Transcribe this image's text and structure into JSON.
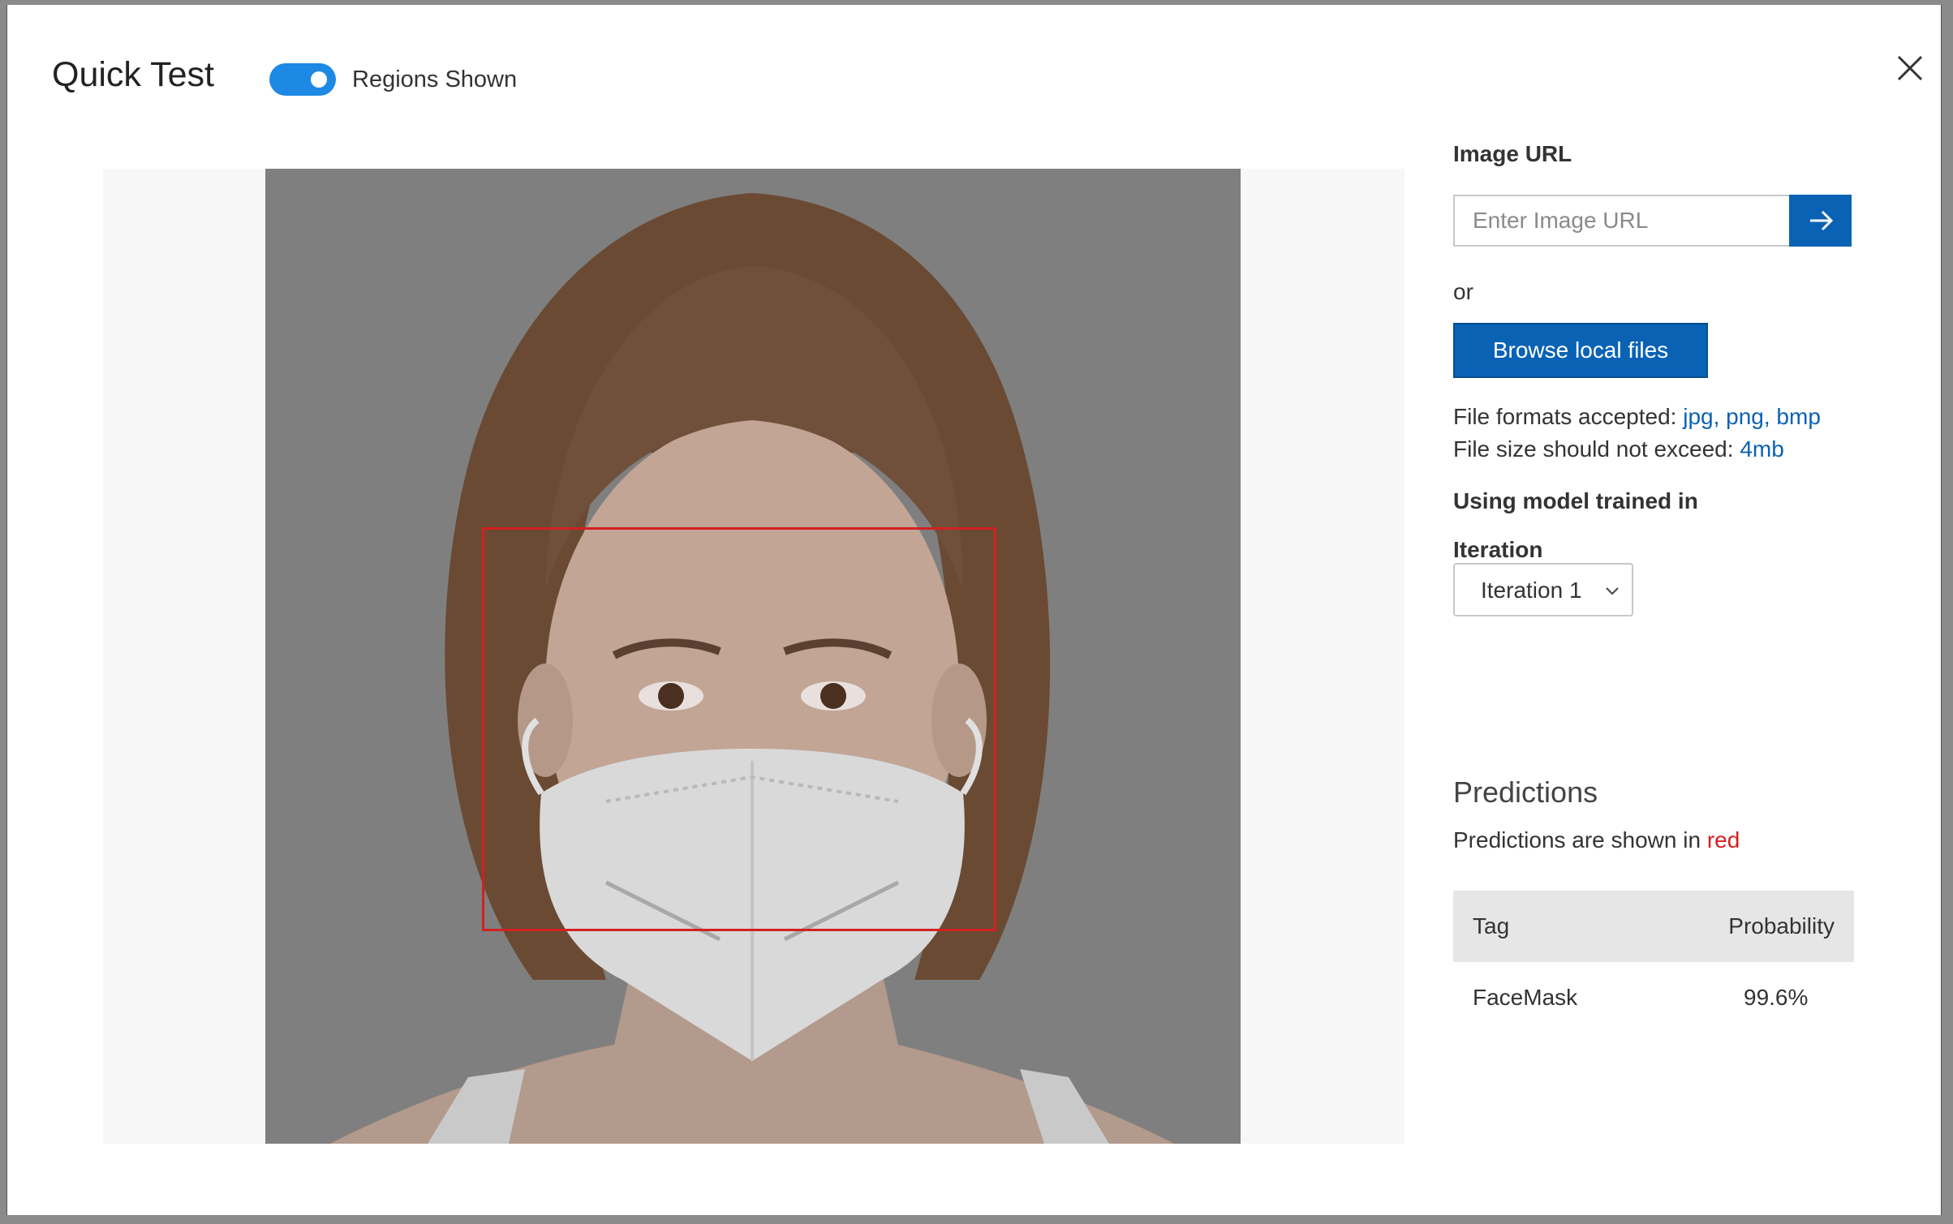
{
  "dialog": {
    "title": "Quick Test",
    "regions_toggle": {
      "label": "Regions Shown",
      "on": true
    }
  },
  "image_url": {
    "label": "Image URL",
    "placeholder": "Enter Image URL"
  },
  "or_text": "or",
  "browse_label": "Browse local files",
  "file_info": {
    "formats_prefix": "File formats accepted:",
    "formats": "jpg, png, bmp",
    "size_prefix": "File size should not exceed:",
    "size": "4mb"
  },
  "model": {
    "heading": "Using model trained in",
    "iteration_label": "Iteration",
    "iteration_value": "Iteration 1"
  },
  "predictions": {
    "title": "Predictions",
    "subtitle_prefix": "Predictions are shown in",
    "subtitle_color_word": "red",
    "columns": {
      "tag": "Tag",
      "probability": "Probability"
    },
    "rows": [
      {
        "tag": "FaceMask",
        "probability": "99.6%"
      }
    ]
  },
  "colors": {
    "accent": "#0a62b5",
    "toggle": "#1e88e5",
    "prediction": "#d32020"
  }
}
